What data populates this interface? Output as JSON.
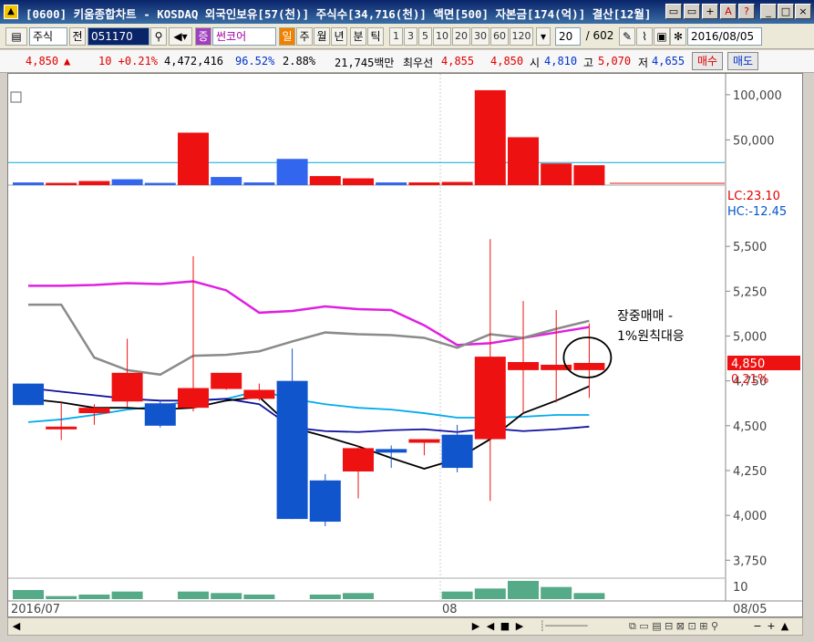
{
  "window": {
    "title": "[0600] 키움종합차트 - KOSDAQ 외국인보유[57(천)] 주식수[34,716(천)] 액면[500] 자본금[174(억)] 결산[12월]",
    "buttons": [
      "▭",
      "▭",
      "+",
      "A",
      "?",
      "_",
      "□",
      "×"
    ]
  },
  "toolbar": {
    "market": "주식",
    "period_prev": "전",
    "code": "051170",
    "search_icon": "magnifier-icon",
    "stock_tag": "증",
    "stock_name": "썬코어",
    "credit_tag": "일",
    "intervals": [
      "주",
      "월",
      "년",
      "분",
      "틱"
    ],
    "minute_options": [
      "1",
      "3",
      "5",
      "10",
      "20",
      "30",
      "60",
      "120"
    ],
    "count": "20",
    "total": "/ 602",
    "date": "2016/08/05"
  },
  "quote": {
    "price": "4,850",
    "direction": "▲",
    "change": "10 +0.21%",
    "volume": "4,472,416",
    "ratio": "96.52%",
    "turnover": "2.88%",
    "amount": "21,745백만",
    "best_label": "최우선",
    "best_ask": "4,855",
    "best_bid": "4,850",
    "open_label": "시",
    "open": "4,810",
    "high_label": "고",
    "high": "5,070",
    "low_label": "저",
    "low": "4,655",
    "buy_button": "매수",
    "sell_button": "매도"
  },
  "chart_data": {
    "type": "candlestick",
    "dates_label_left": "2016/07",
    "dates_label_mid": "08",
    "dates_label_right": "08/05",
    "price_axis": [
      "5,500",
      "5,250",
      "5,000",
      "4,750",
      "4,500",
      "4,250",
      "4,000",
      "3,750"
    ],
    "volume_axis": [
      "100,000",
      "50,000"
    ],
    "indicator_axis": "10",
    "lc_label": "LC:23.10",
    "hc_label": "HC:-12.45",
    "last_price_tag": "4,850",
    "last_change_tag": "0.21%",
    "annotation": [
      "장중매매 -",
      "1%원칙대응"
    ],
    "ylim": [
      3650,
      5750
    ],
    "candles": [
      {
        "o": 4735,
        "c": 4615,
        "h": 4735,
        "l": 4615
      },
      {
        "o": 4480,
        "c": 4495,
        "h": 4630,
        "l": 4420
      },
      {
        "o": 4570,
        "c": 4600,
        "h": 4620,
        "l": 4505
      },
      {
        "o": 4635,
        "c": 4795,
        "h": 4985,
        "l": 4605
      },
      {
        "o": 4625,
        "c": 4500,
        "h": 4640,
        "l": 4490
      },
      {
        "o": 4600,
        "c": 4710,
        "h": 5445,
        "l": 4580
      },
      {
        "o": 4705,
        "c": 4795,
        "h": 4795,
        "l": 4700
      },
      {
        "o": 4650,
        "c": 4700,
        "h": 4735,
        "l": 4640
      },
      {
        "o": 4750,
        "c": 3980,
        "h": 4930,
        "l": 3980
      },
      {
        "o": 4195,
        "c": 3965,
        "h": 4230,
        "l": 3940
      },
      {
        "o": 4245,
        "c": 4375,
        "h": 4390,
        "l": 4095
      },
      {
        "o": 4370,
        "c": 4350,
        "h": 4390,
        "l": 4265
      },
      {
        "o": 4405,
        "c": 4425,
        "h": 4425,
        "l": 4335
      },
      {
        "o": 4450,
        "c": 4265,
        "h": 4505,
        "l": 4240
      },
      {
        "o": 4425,
        "c": 4885,
        "h": 5540,
        "l": 4080
      },
      {
        "o": 4810,
        "c": 4855,
        "h": 5195,
        "l": 4570
      },
      {
        "o": 4810,
        "c": 4840,
        "h": 5145,
        "l": 4630
      },
      {
        "o": 4810,
        "c": 4850,
        "h": 5070,
        "l": 4655
      }
    ],
    "volumes": [
      3000,
      2500,
      4500,
      6500,
      2500,
      58000,
      9000,
      3000,
      29000,
      10000,
      7500,
      3000,
      3000,
      3500,
      105000,
      53000,
      24000,
      22000
    ],
    "volume_colors": [
      "b",
      "r",
      "r",
      "b",
      "b",
      "r",
      "b",
      "b",
      "b",
      "r",
      "r",
      "b",
      "r",
      "r",
      "r",
      "r",
      "r",
      "r"
    ],
    "indicator_bars": [
      6,
      2,
      3,
      5,
      0,
      5,
      4,
      3,
      0,
      3,
      4,
      0,
      0,
      5,
      7,
      12,
      8,
      4
    ],
    "series": [
      {
        "color": "#e020e0",
        "values": [
          5280,
          5280,
          5285,
          5295,
          5290,
          5305,
          5255,
          5130,
          5140,
          5165,
          5150,
          5145,
          5060,
          4950,
          4960,
          4990,
          5020,
          5050
        ]
      },
      {
        "color": "#8a8a8a",
        "values": [
          5175,
          5175,
          4880,
          4810,
          4785,
          4890,
          4895,
          4915,
          4970,
          5020,
          5010,
          5005,
          4990,
          4935,
          5010,
          4990,
          5040,
          5085
        ]
      },
      {
        "color": "#00aaee",
        "values": [
          4520,
          4535,
          4560,
          4590,
          4610,
          4640,
          4650,
          4695,
          4650,
          4620,
          4600,
          4590,
          4570,
          4545,
          4545,
          4550,
          4560,
          4560
        ]
      },
      {
        "color": "#1010a0",
        "values": [
          4710,
          4690,
          4670,
          4650,
          4640,
          4640,
          4650,
          4620,
          4490,
          4470,
          4465,
          4475,
          4480,
          4465,
          4485,
          4470,
          4480,
          4495
        ]
      },
      {
        "color": "#000000",
        "values": [
          4650,
          4630,
          4600,
          4600,
          4590,
          4600,
          4640,
          4660,
          4490,
          4440,
          4385,
          4320,
          4260,
          4315,
          4425,
          4570,
          4640,
          4720
        ]
      }
    ]
  },
  "scroll": {
    "left": "◀",
    "right": "▶",
    "controls": [
      "◀",
      "■",
      "▶"
    ],
    "zoom": [
      "−",
      "+",
      "▲"
    ]
  }
}
